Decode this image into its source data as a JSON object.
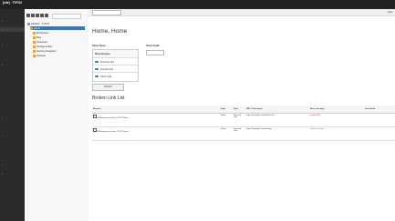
{
  "app": {
    "name": "[site] · TYPO3",
    "version": ""
  },
  "module_menu": [
    {
      "label": ""
    },
    {
      "label": ""
    },
    {
      "label": ""
    },
    {
      "label": ""
    },
    {
      "label": ""
    },
    {
      "label": ""
    },
    {
      "label": ""
    },
    {
      "label": ""
    }
  ],
  "tree": {
    "root": "Website · TYPO3",
    "nodes": [
      "Home",
      "Musterseite",
      "Blog",
      "Newsseite",
      "Storage Folder",
      "Service Navigation",
      "Subseite"
    ]
  },
  "docbar": {
    "select_value": "",
    "view_label": "View"
  },
  "page": {
    "title": "Home, Home",
    "types_label": "Show Types",
    "depth_label": "Show Depth",
    "depth_value": "",
    "types": [
      {
        "label": "Show all types",
        "count": ""
      },
      {
        "label": "External Links",
        "count": ""
      },
      {
        "label": "Internal Links",
        "count": ""
      },
      {
        "label": "Other Links",
        "count": ""
      }
    ],
    "refresh_label": "Refresh",
    "section_title": "Broken Link List",
    "table": {
      "headers": [
        "Element",
        "Page",
        "Type",
        "URL / Link target",
        "Error message",
        "Last check"
      ],
      "rows": [
        {
          "element": "Willkommen auf Ihrer TYPO3 Seite...",
          "page": "Home",
          "type": "External Link",
          "url": "https://example.com/broken-link",
          "msg": "Invalid URL",
          "date": ""
        },
        {
          "element": "Willkommen auf Ihrer TYPO3 Seite...",
          "page": "Home",
          "type": "External Link",
          "url": "https://example.com/missing",
          "msg": "Page not found",
          "date": ""
        }
      ]
    }
  }
}
